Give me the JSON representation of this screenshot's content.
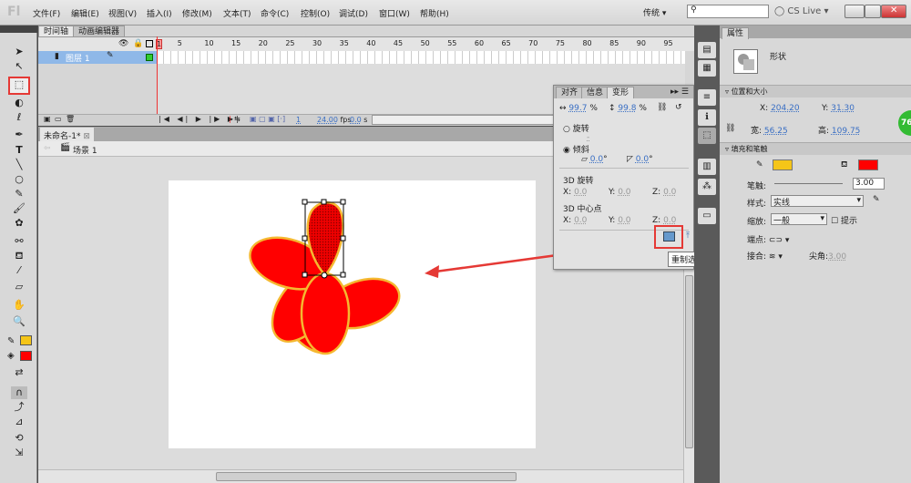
{
  "app": {
    "logo": "Fl",
    "workspace": "传统",
    "cs_live": "CS Live",
    "search_placeholder": ""
  },
  "menu": [
    "文件(F)",
    "编辑(E)",
    "视图(V)",
    "插入(I)",
    "修改(M)",
    "文本(T)",
    "命令(C)",
    "控制(O)",
    "调试(D)",
    "窗口(W)",
    "帮助(H)"
  ],
  "timeline": {
    "tabs": [
      "时间轴",
      "动画编辑器"
    ],
    "frame_numbers": [
      "1",
      "5",
      "10",
      "15",
      "20",
      "25",
      "30",
      "35",
      "40",
      "45",
      "50",
      "55",
      "60",
      "65",
      "70",
      "75",
      "80",
      "85",
      "90",
      "95"
    ],
    "layer_name": "图层 1",
    "current_frame": "1",
    "fps": "24.00",
    "fps_unit": "fps",
    "time": "0.0",
    "time_unit": "s"
  },
  "document": {
    "tab": "未命名-1*",
    "scene": "场景 1"
  },
  "transform": {
    "tabs": [
      "对齐",
      "信息",
      "变形"
    ],
    "scale_w": "99.7",
    "scale_h": "99.8",
    "pct": "%",
    "rotate_label": "旋转",
    "rotate_val": "-",
    "skew_label": "倾斜",
    "skew_h": "0.0",
    "skew_v": "0.0",
    "deg": "°",
    "rot3d_label": "3D 旋转",
    "rot3d": {
      "x": "0.0",
      "y": "0.0",
      "z": "0.0"
    },
    "center3d_label": "3D 中心点",
    "center3d": {
      "x": "0.0",
      "y": "0.0",
      "z": "0.0"
    },
    "tooltip": "重制选区和变形"
  },
  "properties": {
    "tab": "属性",
    "type": "形状",
    "pos_section": "位置和大小",
    "x_label": "X:",
    "x": "204.20",
    "y_label": "Y:",
    "y": "31.30",
    "w_label": "宽:",
    "w": "56.25",
    "h_label": "高:",
    "h": "109.75",
    "fill_section": "填充和笔触",
    "stroke_color": "#f5c518",
    "fill_color": "#ff0000",
    "stroke_label": "笔触:",
    "stroke_val": "3.00",
    "style_label": "样式:",
    "style_val": "实线",
    "scale_label": "缩放:",
    "scale_val": "一般",
    "hint_label": "提示",
    "cap_label": "端点:",
    "join_label": "接合:",
    "miter_label": "尖角:",
    "miter_val": "3.00"
  },
  "badge": "76",
  "colors": {
    "petal_fill": "#ff0000",
    "petal_stroke": "#f5b830",
    "highlight": "#e53935"
  }
}
